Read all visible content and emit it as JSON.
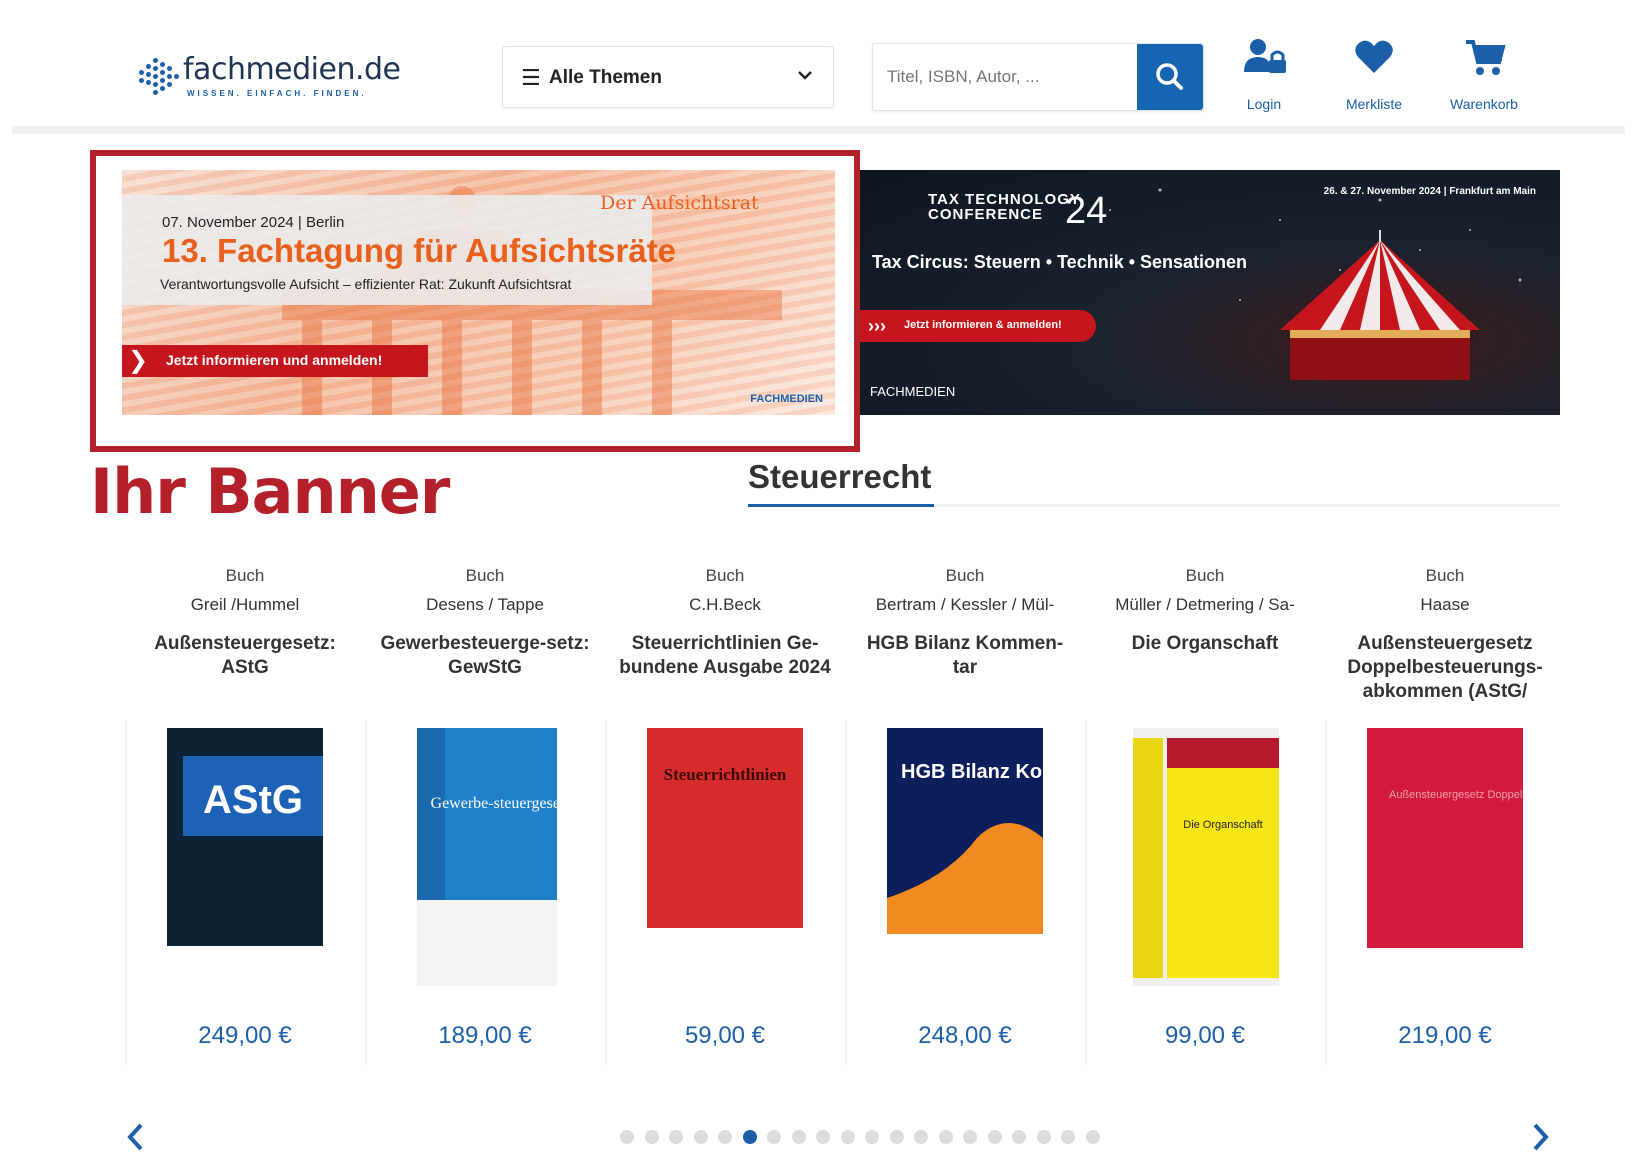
{
  "header": {
    "logo_text": "fachmedien.de",
    "logo_tagline": "WISSEN. EINFACH. FINDEN.",
    "themes_label": "Alle Themen",
    "search_placeholder": "Titel, ISBN, Autor, ...",
    "icons": [
      {
        "name": "login",
        "label": "Login",
        "icon": "user-lock-icon"
      },
      {
        "name": "merkliste",
        "label": "Merkliste",
        "icon": "heart-icon"
      },
      {
        "name": "warenkorb",
        "label": "Warenkorb",
        "icon": "cart-icon"
      }
    ],
    "accent_color": "#1565b0"
  },
  "banner_left": {
    "date": "07. November 2024 | Berlin",
    "title": "13. Fachtagung für Aufsichtsräte",
    "subtitle": "Verantwortungsvolle Aufsicht – effizienter Rat: Zukunft Aufsichtsrat",
    "brand": "Der Aufsichtsrat",
    "cta": "Jetzt informieren und anmelden!",
    "logo": "FACHMEDIEN"
  },
  "banner_right": {
    "title_line1": "TAX TECHNOLOGY",
    "title_line2": "CONFERENCE",
    "number": "24",
    "date": "26. & 27. November 2024 | Frankfurt am Main",
    "subtitle": "Tax Circus: Steuern • Technik • Sensationen",
    "cta": "Jetzt informieren & anmelden!",
    "logo": "FACHMEDIEN"
  },
  "overlay_label": "Ihr Banner",
  "overlay_color": "#b3202a",
  "section": {
    "title": "Steuerrecht"
  },
  "products": [
    {
      "type": "Buch",
      "author": "Greil /Hummel",
      "title": "Außensteuergesetz: AStG",
      "price": "249,00 €",
      "cover_text": "AStG"
    },
    {
      "type": "Buch",
      "author": "Desens / Tappe",
      "title": "Gewerbesteuerge-setz: GewStG",
      "price": "189,00 €",
      "cover_text": "Gewerbe-steuergesetz"
    },
    {
      "type": "Buch",
      "author": "C.H.Beck",
      "title": "Steuerrichtlinien Ge-bundene Ausgabe 2024",
      "price": "59,00 €",
      "cover_text": "Steuerrichtlinien"
    },
    {
      "type": "Buch",
      "author": "Bertram / Kessler / Mül-",
      "title": "HGB Bilanz Kommen-tar",
      "price": "248,00 €",
      "cover_text": "HGB Bilanz Kommentar"
    },
    {
      "type": "Buch",
      "author": "Müller / Detmering / Sa-",
      "title": "Die Organschaft",
      "price": "99,00 €",
      "cover_text": "Die Organschaft"
    },
    {
      "type": "Buch",
      "author": "Haase",
      "title": "Außensteuergesetz Doppelbesteuerungs-abkommen (AStG/",
      "price": "219,00 €",
      "cover_text": "Außensteuergesetz Doppelbesteuerungsabkommen"
    }
  ],
  "carousel": {
    "total_pages": 20,
    "active_page": 6
  }
}
